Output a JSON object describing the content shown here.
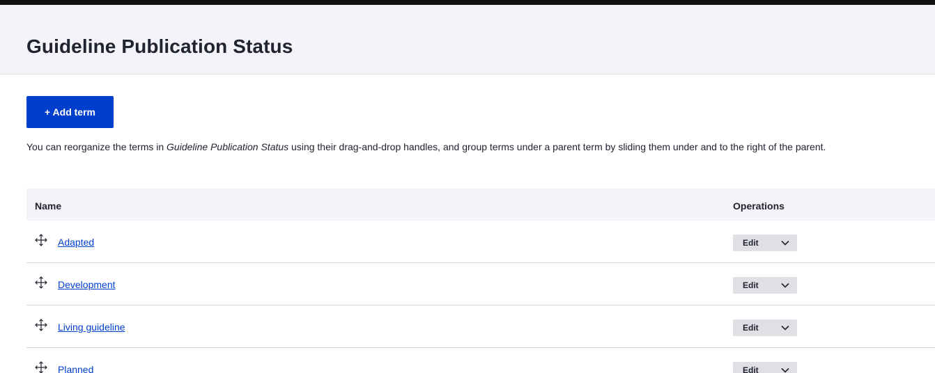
{
  "page": {
    "title": "Guideline Publication Status"
  },
  "actions": {
    "add_term_label": "+ Add term"
  },
  "help": {
    "before": "You can reorganize the terms in ",
    "vocabulary": "Guideline Publication Status",
    "after": " using their drag-and-drop handles, and group terms under a parent term by sliding them under and to the right of the parent."
  },
  "table": {
    "headers": {
      "name": "Name",
      "operations": "Operations"
    },
    "rows": [
      {
        "name": "Adapted",
        "edit": "Edit"
      },
      {
        "name": "Development",
        "edit": "Edit"
      },
      {
        "name": "Living guideline",
        "edit": "Edit"
      },
      {
        "name": "Planned",
        "edit": "Edit"
      }
    ]
  },
  "icons": {
    "drag": "drag-handle-icon",
    "dropdown": "chevron-down-icon"
  },
  "colors": {
    "primary": "#003ecc",
    "header_bg": "#f3f4f9",
    "ops_bg": "#dfe0e5"
  }
}
